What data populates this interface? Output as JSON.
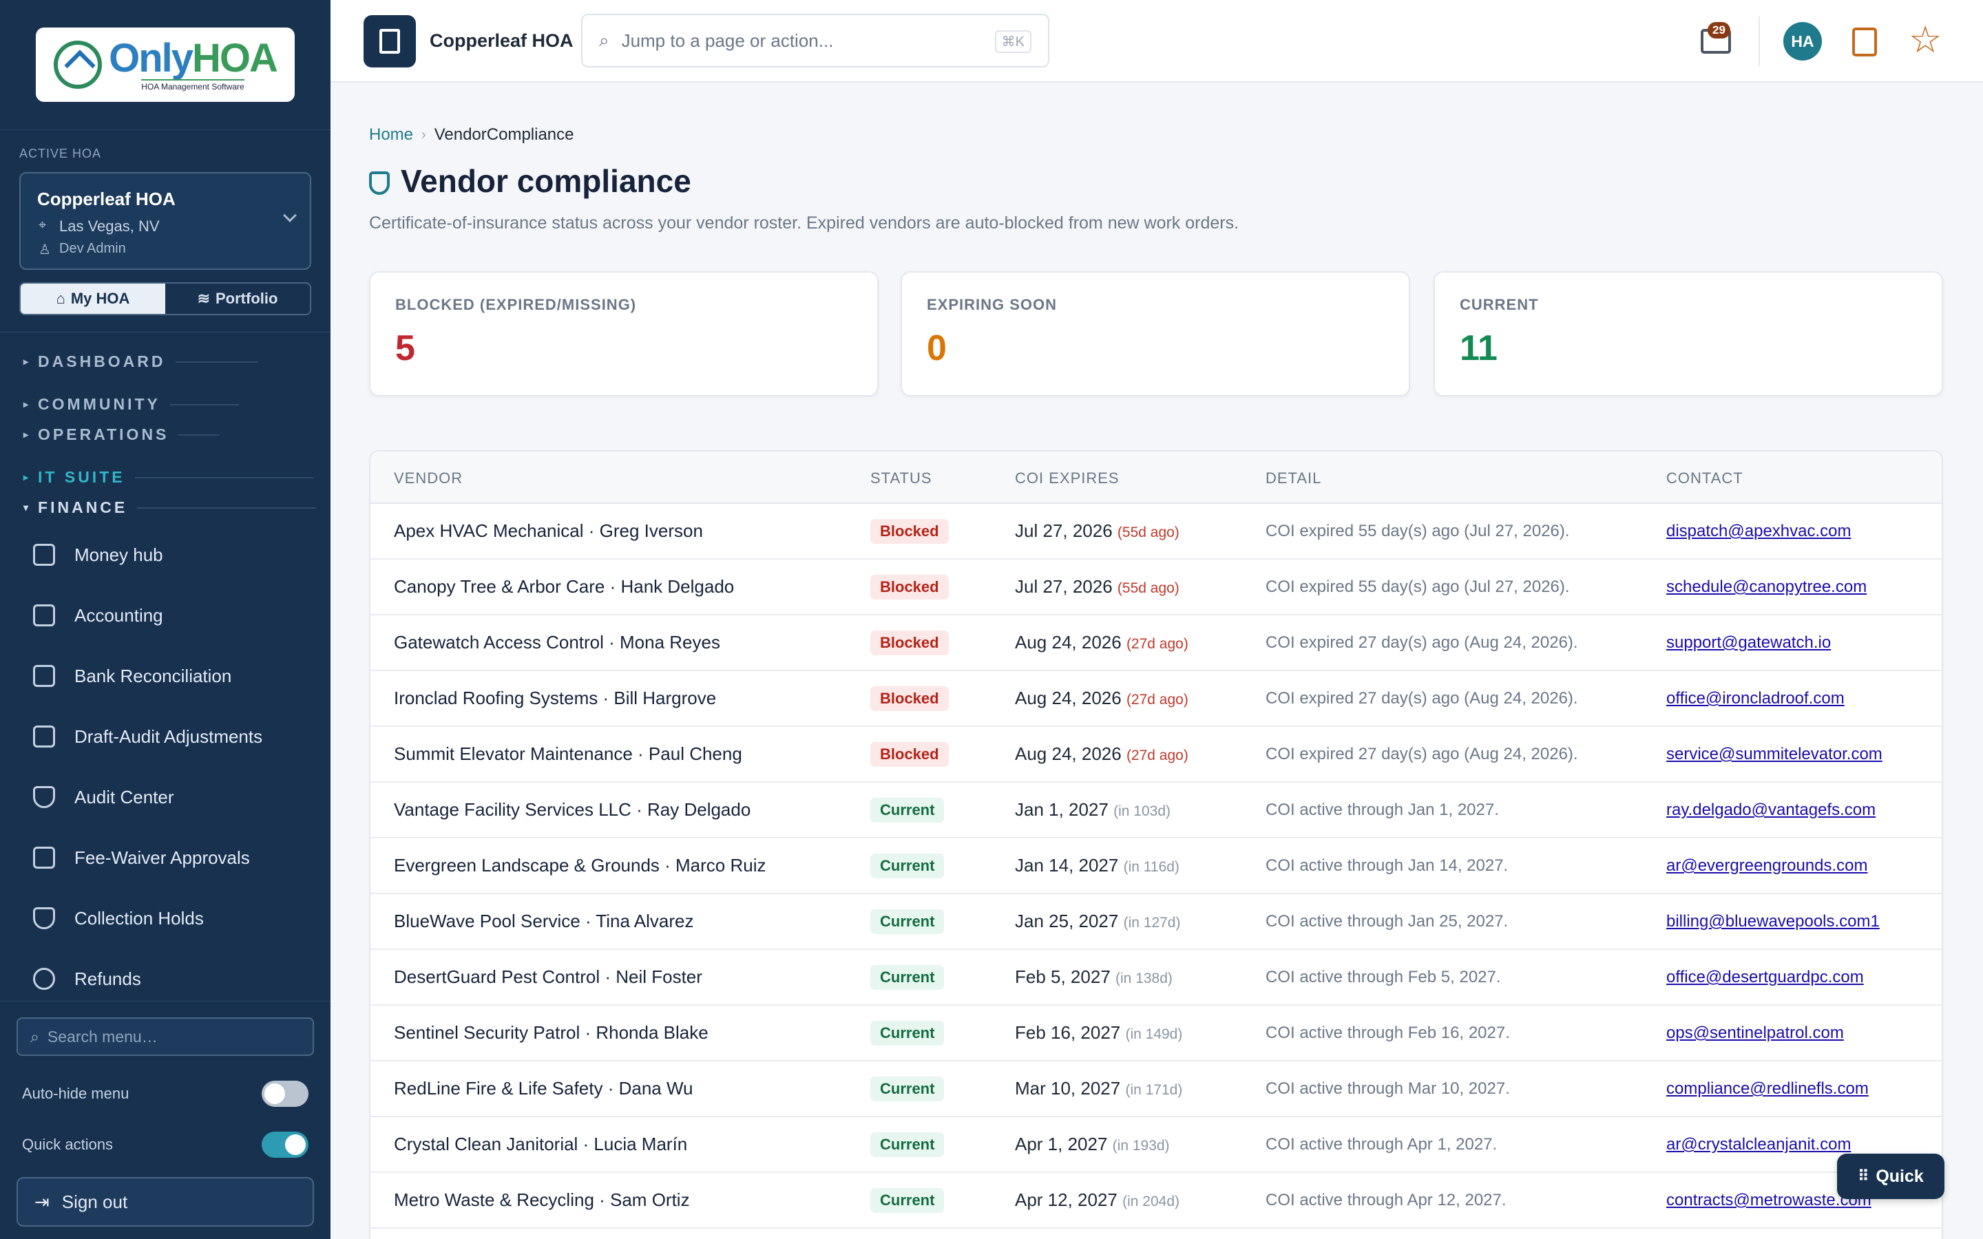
{
  "brand": {
    "logo_name_a": "Only",
    "logo_name_b": "HOA",
    "logo_tagline": "HOA Management Software"
  },
  "sidebar": {
    "active_label": "ACTIVE HOA",
    "hoa_name": "Copperleaf HOA",
    "hoa_location": "Las Vegas, NV",
    "hoa_user": "Dev Admin",
    "seg_my_hoa": "My HOA",
    "seg_portfolio": "Portfolio",
    "groups": [
      {
        "label": "DASHBOARD"
      },
      {
        "label": "COMMUNITY"
      },
      {
        "label": "OPERATIONS"
      },
      {
        "label": "IT SUITE"
      },
      {
        "label": "FINANCE"
      }
    ],
    "items": [
      {
        "label": "Money hub"
      },
      {
        "label": "Accounting"
      },
      {
        "label": "Bank Reconciliation"
      },
      {
        "label": "Draft-Audit Adjustments"
      },
      {
        "label": "Audit Center"
      },
      {
        "label": "Fee-Waiver Approvals"
      },
      {
        "label": "Collection Holds"
      },
      {
        "label": "Refunds"
      }
    ],
    "search_placeholder": "Search menu…",
    "auto_hide_label": "Auto-hide menu",
    "auto_hide_on": false,
    "quick_actions_label": "Quick actions",
    "quick_actions_on": true,
    "sign_out": "Sign out"
  },
  "topbar": {
    "hoa_name": "Copperleaf HOA",
    "command_placeholder": "Jump to a page or action...",
    "shortcut": "⌘K",
    "inbox_count": "29",
    "avatar_initials": "HA"
  },
  "breadcrumb": {
    "home": "Home",
    "current": "VendorCompliance"
  },
  "page": {
    "title": "Vendor compliance",
    "subtitle": "Certificate-of-insurance status across your vendor roster. Expired vendors are auto-blocked from new work orders."
  },
  "stats": [
    {
      "label": "BLOCKED (EXPIRED/MISSING)",
      "value": "5",
      "color": "#c0262d"
    },
    {
      "label": "EXPIRING SOON",
      "value": "0",
      "color": "#d97706"
    },
    {
      "label": "CURRENT",
      "value": "11",
      "color": "#138a52"
    }
  ],
  "table": {
    "headers": {
      "vendor": "VENDOR",
      "status": "STATUS",
      "expires": "COI EXPIRES",
      "detail": "DETAIL",
      "contact": "CONTACT"
    },
    "rows": [
      {
        "vendor": "Apex HVAC Mechanical · Greg Iverson",
        "status": "Blocked",
        "expires": "Jul 27, 2026",
        "relative": "(55d ago)",
        "detail": "COI expired 55 day(s) ago (Jul 27, 2026).",
        "contact": "dispatch@apexhvac.com"
      },
      {
        "vendor": "Canopy Tree & Arbor Care · Hank Delgado",
        "status": "Blocked",
        "expires": "Jul 27, 2026",
        "relative": "(55d ago)",
        "detail": "COI expired 55 day(s) ago (Jul 27, 2026).",
        "contact": "schedule@canopytree.com"
      },
      {
        "vendor": "Gatewatch Access Control · Mona Reyes",
        "status": "Blocked",
        "expires": "Aug 24, 2026",
        "relative": "(27d ago)",
        "detail": "COI expired 27 day(s) ago (Aug 24, 2026).",
        "contact": "support@gatewatch.io"
      },
      {
        "vendor": "Ironclad Roofing Systems · Bill Hargrove",
        "status": "Blocked",
        "expires": "Aug 24, 2026",
        "relative": "(27d ago)",
        "detail": "COI expired 27 day(s) ago (Aug 24, 2026).",
        "contact": "office@ironcladroof.com"
      },
      {
        "vendor": "Summit Elevator Maintenance · Paul Cheng",
        "status": "Blocked",
        "expires": "Aug 24, 2026",
        "relative": "(27d ago)",
        "detail": "COI expired 27 day(s) ago (Aug 24, 2026).",
        "contact": "service@summitelevator.com"
      },
      {
        "vendor": "Vantage Facility Services LLC · Ray Delgado",
        "status": "Current",
        "expires": "Jan 1, 2027",
        "relative": "(in 103d)",
        "detail": "COI active through Jan 1, 2027.",
        "contact": "ray.delgado@vantagefs.com"
      },
      {
        "vendor": "Evergreen Landscape & Grounds · Marco Ruiz",
        "status": "Current",
        "expires": "Jan 14, 2027",
        "relative": "(in 116d)",
        "detail": "COI active through Jan 14, 2027.",
        "contact": "ar@evergreengrounds.com"
      },
      {
        "vendor": "BlueWave Pool Service · Tina Alvarez",
        "status": "Current",
        "expires": "Jan 25, 2027",
        "relative": "(in 127d)",
        "detail": "COI active through Jan 25, 2027.",
        "contact": "billing@bluewavepools.com1"
      },
      {
        "vendor": "DesertGuard Pest Control · Neil Foster",
        "status": "Current",
        "expires": "Feb 5, 2027",
        "relative": "(in 138d)",
        "detail": "COI active through Feb 5, 2027.",
        "contact": "office@desertguardpc.com"
      },
      {
        "vendor": "Sentinel Security Patrol · Rhonda Blake",
        "status": "Current",
        "expires": "Feb 16, 2027",
        "relative": "(in 149d)",
        "detail": "COI active through Feb 16, 2027.",
        "contact": "ops@sentinelpatrol.com"
      },
      {
        "vendor": "RedLine Fire & Life Safety · Dana Wu",
        "status": "Current",
        "expires": "Mar 10, 2027",
        "relative": "(in 171d)",
        "detail": "COI active through Mar 10, 2027.",
        "contact": "compliance@redlinefls.com"
      },
      {
        "vendor": "Crystal Clean Janitorial · Lucia Marín",
        "status": "Current",
        "expires": "Apr 1, 2027",
        "relative": "(in 193d)",
        "detail": "COI active through Apr 1, 2027.",
        "contact": "ar@crystalcleanjanit.com"
      },
      {
        "vendor": "Metro Waste & Recycling · Sam Ortiz",
        "status": "Current",
        "expires": "Apr 12, 2027",
        "relative": "(in 204d)",
        "detail": "COI active through Apr 12, 2027.",
        "contact": "contracts@metrowaste.com"
      }
    ]
  },
  "quick_button": "Quick"
}
